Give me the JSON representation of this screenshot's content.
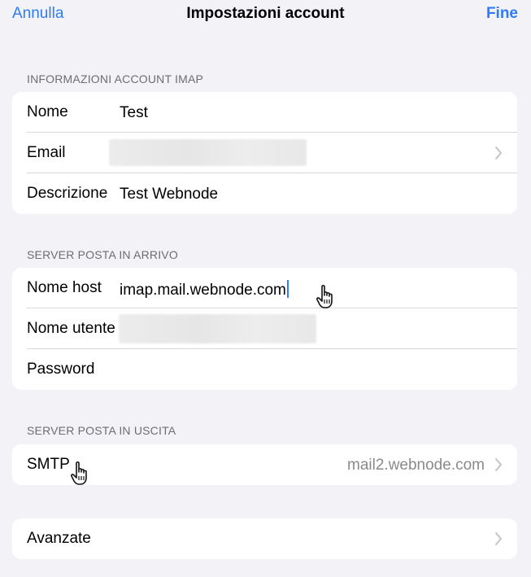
{
  "nav": {
    "cancel_label": "Annulla",
    "title": "Impostazioni account",
    "done_label": "Fine"
  },
  "sections": {
    "imap": {
      "header": "INFORMAZIONI ACCOUNT IMAP",
      "name_label": "Nome",
      "name_value": "Test",
      "email_label": "Email",
      "email_value": "",
      "description_label": "Descrizione",
      "description_value": "Test Webnode"
    },
    "incoming": {
      "header": "SERVER POSTA IN ARRIVO",
      "host_label": "Nome host",
      "host_value": "imap.mail.webnode.com",
      "username_label": "Nome utente",
      "username_value": "",
      "password_label": "Password",
      "password_value": ""
    },
    "outgoing": {
      "header": "SERVER POSTA IN USCITA",
      "smtp_label": "SMTP",
      "smtp_value": "mail2.webnode.com"
    },
    "advanced": {
      "label": "Avanzate"
    }
  },
  "icons": {
    "chevron": "chevron-right-icon",
    "cursor": "hand-pointer-icon"
  },
  "colors": {
    "accent": "#2f7cf6",
    "background": "#f2f2f7",
    "secondary_text": "#8a8a8e",
    "section_header": "#6d6d72"
  }
}
